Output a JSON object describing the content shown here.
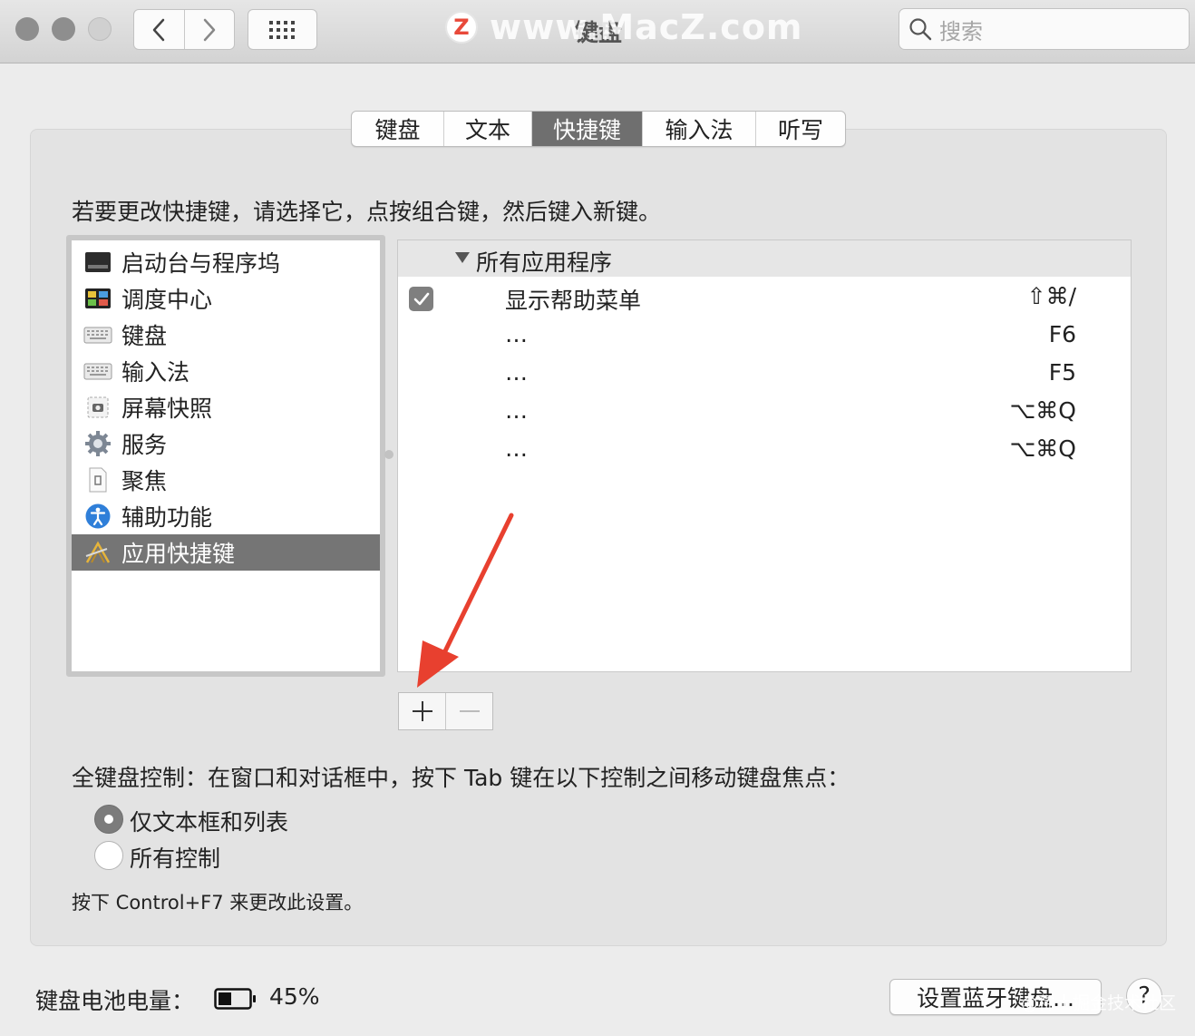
{
  "window": {
    "title": "键盘"
  },
  "watermark": {
    "logo_letter": "Z",
    "site": "www.MacZ.com",
    "footer": "@稀土掘金技术社区"
  },
  "search": {
    "placeholder": "搜索"
  },
  "tabs": [
    {
      "label": "键盘",
      "active": false
    },
    {
      "label": "文本",
      "active": false
    },
    {
      "label": "快捷键",
      "active": true
    },
    {
      "label": "输入法",
      "active": false
    },
    {
      "label": "听写",
      "active": false
    }
  ],
  "instruction": "若要更改快捷键，请选择它，点按组合键，然后键入新键。",
  "categories": [
    {
      "label": "启动台与程序坞",
      "icon": "launchpad-dock-icon",
      "selected": false
    },
    {
      "label": "调度中心",
      "icon": "mission-control-icon",
      "selected": false
    },
    {
      "label": "键盘",
      "icon": "keyboard-icon",
      "selected": false
    },
    {
      "label": "输入法",
      "icon": "input-method-icon",
      "selected": false
    },
    {
      "label": "屏幕快照",
      "icon": "screenshot-icon",
      "selected": false
    },
    {
      "label": "服务",
      "icon": "gear-icon",
      "selected": false
    },
    {
      "label": "聚焦",
      "icon": "spotlight-icon",
      "selected": false
    },
    {
      "label": "辅助功能",
      "icon": "accessibility-icon",
      "selected": false
    },
    {
      "label": "应用快捷键",
      "icon": "app-shortcuts-icon",
      "selected": true
    }
  ],
  "shortcuts": {
    "group": "所有应用程序",
    "rows": [
      {
        "name": "显示帮助菜单",
        "key": "⇧⌘/",
        "checked": true
      },
      {
        "name": "…",
        "key": "F6",
        "checked": false
      },
      {
        "name": "…",
        "key": "F5",
        "checked": false
      },
      {
        "name": "…",
        "key": "⌥⌘Q",
        "checked": false
      },
      {
        "name": "…",
        "key": "⌥⌘Q",
        "checked": false
      }
    ]
  },
  "full_keyboard": {
    "label": "全键盘控制：在窗口和对话框中，按下 Tab 键在以下控制之间移动键盘焦点：",
    "options": [
      {
        "label": "仅文本框和列表",
        "selected": true
      },
      {
        "label": "所有控制",
        "selected": false
      }
    ],
    "hint": "按下 Control+F7 来更改此设置。"
  },
  "battery": {
    "label": "键盘电池电量：",
    "percent_text": "45%",
    "level": 0.45
  },
  "bluetooth_button": "设置蓝牙键盘...",
  "help_button": "?",
  "colors": {
    "selection": "#757575",
    "arrow": "#e8402f"
  }
}
